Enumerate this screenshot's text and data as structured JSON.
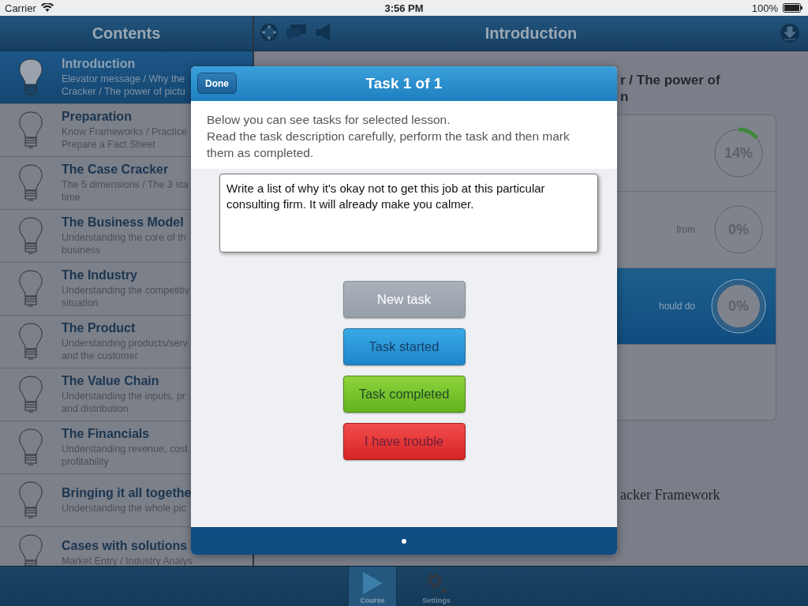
{
  "status_bar": {
    "carrier": "Carrier",
    "time": "3:56 PM",
    "battery": "100%"
  },
  "sidebar": {
    "title": "Contents",
    "items": [
      {
        "title": "Introduction",
        "subtitle": [
          "Elevator message / Why the",
          "Cracker / The power of pictu"
        ],
        "selected": true
      },
      {
        "title": "Preparation",
        "subtitle": [
          "Know Frameworks / Practice",
          "Prepare a Fact Sheet"
        ],
        "selected": false
      },
      {
        "title": "The Case Cracker",
        "subtitle": [
          "The 5 dimensions / The 3 sta",
          "time"
        ],
        "selected": false
      },
      {
        "title": "The Business Model",
        "subtitle": [
          "Understanding the core of th",
          "business"
        ],
        "selected": false
      },
      {
        "title": "The Industry",
        "subtitle": [
          "Understanding the competitiv",
          "situation"
        ],
        "selected": false
      },
      {
        "title": "The Product",
        "subtitle": [
          "Understanding products/serv",
          "and the customer"
        ],
        "selected": false
      },
      {
        "title": "The Value Chain",
        "subtitle": [
          "Understanding the inputs, pr",
          "and distribution"
        ],
        "selected": false
      },
      {
        "title": "The Financials",
        "subtitle": [
          "Understanding revenue, cost",
          "profitability"
        ],
        "selected": false
      },
      {
        "title": "Bringing it all togethe",
        "subtitle": [
          "Understanding the whole pic"
        ],
        "selected": false
      },
      {
        "title": "Cases with solutions",
        "subtitle": [
          "Market Entry / Industry Analys"
        ],
        "selected": false
      }
    ]
  },
  "main": {
    "title": "Introduction",
    "heading": [
      "r / The power of",
      "n"
    ],
    "lessons": [
      {
        "reading": "14%",
        "selected": false
      },
      {
        "text": "from",
        "reading": "0%",
        "selected": false
      },
      {
        "text": "hould do",
        "reading": "0%",
        "selected": true
      }
    ],
    "footer_text": "acker Framework"
  },
  "dialog": {
    "title": "Task 1 of 1",
    "done": "Done",
    "intro": [
      "Below you can see tasks for selected lesson.",
      "Read the task description carefully, perform the task and then mark them as completed."
    ],
    "task": "Write a list of why it's okay not to get this job at this particular consulting firm. It will already make you calmer.",
    "buttons": [
      {
        "label": "New task",
        "kind": "new"
      },
      {
        "label": "Task started",
        "kind": "started"
      },
      {
        "label": "Task completed",
        "kind": "completed"
      },
      {
        "label": "I have trouble",
        "kind": "trouble"
      }
    ]
  },
  "tab_bar": [
    {
      "label": "Course",
      "kind": "play",
      "selected": true
    },
    {
      "label": "Settings",
      "kind": "gear",
      "selected": false
    }
  ]
}
